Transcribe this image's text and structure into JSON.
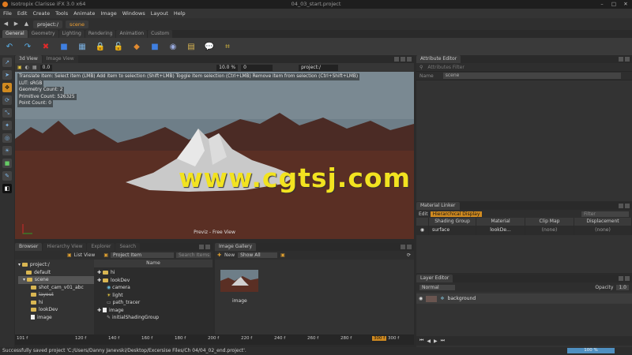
{
  "window": {
    "app_title": "Isotropix Clarisse iFX 3.0 x64",
    "doc_title": "04_03_start.project"
  },
  "menu": [
    "File",
    "Edit",
    "Create",
    "Tools",
    "Animate",
    "Image",
    "Windows",
    "Layout",
    "Help"
  ],
  "address": {
    "crumbs": [
      "project:/",
      "scene"
    ]
  },
  "shelf_tabs": [
    "General",
    "Geometry",
    "Lighting",
    "Rendering",
    "Animation",
    "Custom"
  ],
  "viewer": {
    "tabs": [
      "3d View",
      "Image View"
    ],
    "fields": {
      "f1": "0.0",
      "zoom": "10.0 %",
      "frame": "0",
      "path": "project:/"
    },
    "overlay": {
      "hint": "Translate Item: Select item (LMB)  Add item to selection (Shift+LMB)  Toggle item selection (Ctrl+LMB)  Remove item from selection (Ctrl+Shift+LMB)",
      "lut": "LUT: sRGB",
      "geometry": "Geometry Count: 2",
      "primitive": "Primitive Count: 526325",
      "point": "Point Count: 0"
    },
    "caption": "Previz - Free View"
  },
  "watermark": "www.cgtsj.com",
  "attribute_editor": {
    "title": "Attribute Editor",
    "filter_placeholder": "Attributes Filter",
    "name_label": "Name",
    "name_value": "scene"
  },
  "material_linker": {
    "title": "Material Linker",
    "tabs": [
      "Edit",
      "Hierarchical Display"
    ],
    "filter_placeholder": "Filter",
    "columns": [
      "Shading Group",
      "Material",
      "Clip Map",
      "Displacement"
    ],
    "rows": [
      {
        "group": "surface",
        "material": "lookDe...",
        "clip": "(none)",
        "disp": "(none)"
      }
    ]
  },
  "layer_editor": {
    "title": "Layer Editor",
    "blend": "Normal",
    "opacity_label": "Opacity",
    "opacity": "1.0",
    "layer": "background"
  },
  "browser": {
    "tabs": [
      "Browser",
      "Hierarchy View",
      "Explorer",
      "Search"
    ],
    "view_mode": "List View",
    "filter_label": "Project Item",
    "search_placeholder": "Search Items",
    "tree": [
      "project:/",
      "default",
      "scene",
      "shot_cam_v01_abc",
      "layout",
      "hi",
      "lookDev",
      "image"
    ],
    "list_header": "Name",
    "list": [
      "hi",
      "lookDev",
      "camera",
      "light",
      "path_tracer",
      "image",
      "initialShadingGroup"
    ]
  },
  "gallery": {
    "title": "Image Gallery",
    "new_label": "New",
    "show": "Show All",
    "thumb_label": "image"
  },
  "timeline": {
    "start": "101 f",
    "ticks": [
      "120 f",
      "140 f",
      "160 f",
      "180 f",
      "200 f",
      "220 f",
      "240 f",
      "260 f",
      "280 f",
      "300 f"
    ],
    "end": "300 f",
    "current_label": "Current",
    "current": "300 f"
  },
  "status": {
    "message": "Successfully saved project 'C:/Users/Danny Janevski/Desktop/Excersise Files/Ch 04/04_02_end.project'.",
    "progress": "100 %"
  },
  "colors": {
    "accent": "#f0a030",
    "sky": "#6c7c86",
    "ground": "#5a2e23"
  }
}
